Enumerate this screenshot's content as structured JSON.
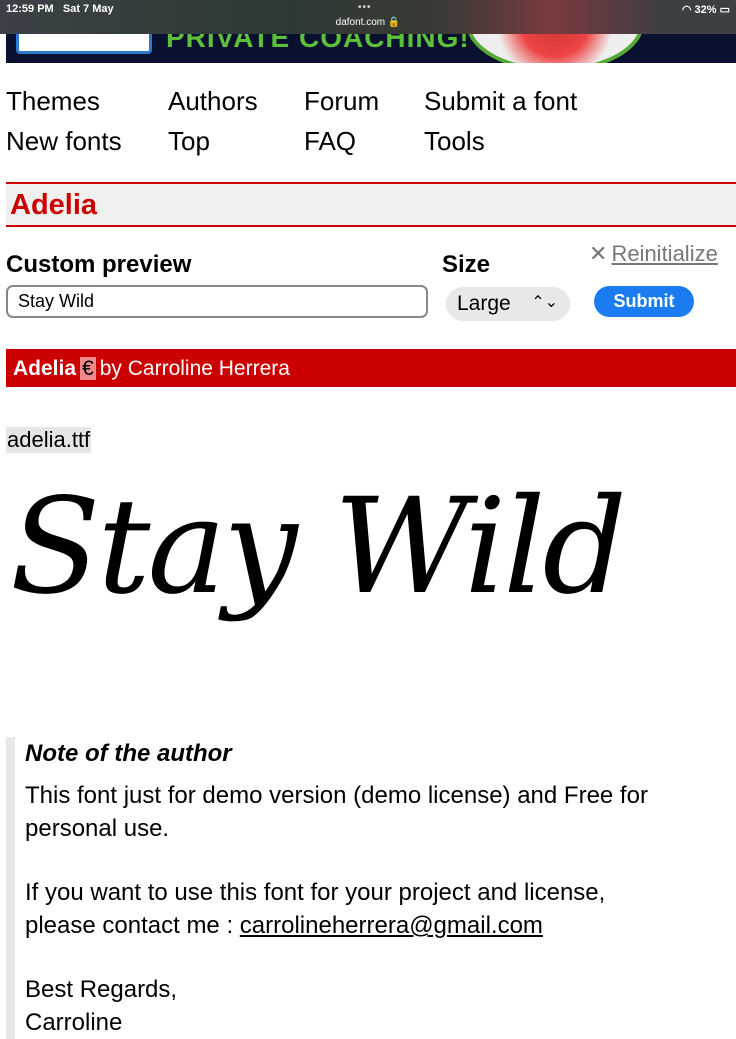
{
  "status_bar": {
    "time": "12:59 PM",
    "date": "Sat 7 May",
    "url": "dafont.com",
    "battery": "32%"
  },
  "banner": {
    "text": "PRIVATE COACHING!"
  },
  "nav": [
    "Themes",
    "Authors",
    "Forum",
    "Submit a font",
    "New fonts",
    "Top",
    "FAQ",
    "Tools"
  ],
  "font_title": "Adelia",
  "custom_preview": {
    "label": "Custom preview",
    "value": "Stay Wild"
  },
  "size": {
    "label": "Size",
    "selected": "Large"
  },
  "reinitialize": "Reinitialize",
  "submit": "Submit",
  "font_bar": {
    "name": "Adelia",
    "badge": "€",
    "by": "by Carroline Herrera"
  },
  "file": "adelia.ttf",
  "preview_text": "Stay Wild",
  "note": {
    "title": "Note of the author",
    "line1": "This font just for demo version (demo license) and Free for personal use.",
    "line2": "If you want to use this font for your project and license,",
    "line3": "please contact me : ",
    "email": "carrolineherrera@gmail.com",
    "line4": "Best Regards,",
    "line5": "Carroline"
  },
  "colors": {
    "accent": "#cc0000",
    "button": "#1a7cf0"
  }
}
